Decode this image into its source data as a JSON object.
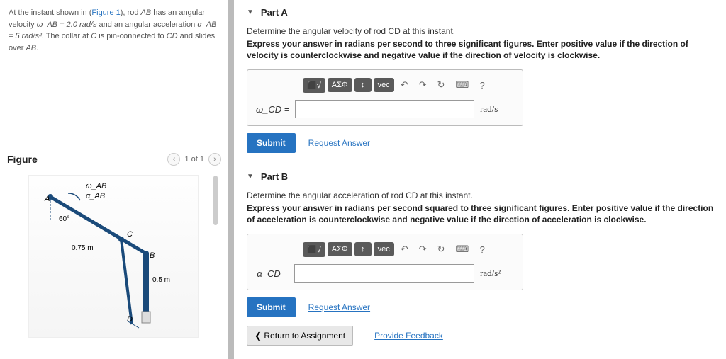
{
  "problem": {
    "prefix": "At the instant shown in (",
    "figure_link": "Figure 1",
    "mid1": "), rod ",
    "rodAB": "AB",
    "mid2": " has an angular velocity ",
    "omegaAB": "ω_AB = 2.0 rad/s",
    "mid3": " and an angular acceleration ",
    "alphaAB": "α_AB = 5 rad/s²",
    "mid4": ". The collar at ",
    "ptC": "C",
    "mid5": " is pin-connected to ",
    "rodCD": "CD",
    "mid6": " and slides over ",
    "rodAB2": "AB",
    "period": "."
  },
  "figure": {
    "title": "Figure",
    "page": "1 of 1",
    "labels": {
      "omega": "ω_AB",
      "alpha": "α_AB",
      "A": "A",
      "B": "B",
      "C": "C",
      "D": "D",
      "angle": "60°",
      "len1": "0.75 m",
      "len2": "0.5 m"
    }
  },
  "partA": {
    "title": "Part A",
    "prompt": "Determine the angular velocity of rod CD at this instant.",
    "instructions": "Express your answer in radians per second to three significant figures. Enter positive value if the direction of velocity is counterclockwise and negative value if the direction of velocity is clockwise.",
    "var": "ω_CD =",
    "unit": "rad/s",
    "submit": "Submit",
    "request": "Request Answer"
  },
  "partB": {
    "title": "Part B",
    "prompt": "Determine the angular acceleration of rod CD at this instant.",
    "instructions": "Express your answer in radians per second squared to three significant figures. Enter positive value if the direction of acceleration is counterclockwise and negative value if the direction of acceleration is clockwise.",
    "var": "α_CD =",
    "unit": "rad/s²",
    "submit": "Submit",
    "request": "Request Answer"
  },
  "toolbar": {
    "templates": "⬛√",
    "greek": "ΑΣΦ",
    "subsup": "↕",
    "vec": "vec",
    "undo": "↶",
    "redo": "↷",
    "reset": "↻",
    "keyboard": "⌨",
    "help": "?"
  },
  "footer": {
    "return": "❮ Return to Assignment",
    "feedback": "Provide Feedback"
  }
}
